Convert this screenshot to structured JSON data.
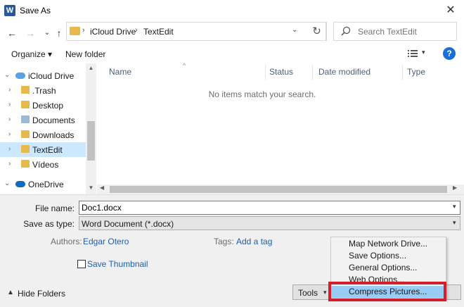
{
  "window": {
    "title": "Save As",
    "app_icon": "W",
    "close": "✕"
  },
  "nav": {
    "back": "←",
    "forward": "→",
    "recent": "⌄",
    "up": "↑",
    "refresh": "↻"
  },
  "address": {
    "segments": [
      "iCloud Drive",
      "TextEdit"
    ],
    "sep": "›",
    "dropdown": "⌄"
  },
  "search": {
    "placeholder": "Search TextEdit"
  },
  "toolbar": {
    "organize": "Organize ▾",
    "new_folder": "New folder",
    "view_chev": "▾",
    "help": "?"
  },
  "sidebar": {
    "items": [
      {
        "label": "iCloud Drive",
        "chev": "⌄",
        "icon": "cloud-icon"
      },
      {
        "label": ".Trash",
        "chev": "›",
        "icon": "folder-icon"
      },
      {
        "label": "Desktop",
        "chev": "›",
        "icon": "folder-icon"
      },
      {
        "label": "Documents",
        "chev": "›",
        "icon": "documents-icon"
      },
      {
        "label": "Downloads",
        "chev": "›",
        "icon": "folder-icon"
      },
      {
        "label": "TextEdit",
        "chev": "›",
        "icon": "folder-icon",
        "selected": true
      },
      {
        "label": "Vídeos",
        "chev": "›",
        "icon": "folder-icon"
      },
      {
        "label": "OneDrive",
        "chev": "⌄",
        "icon": "onedrive-icon"
      }
    ]
  },
  "filelist": {
    "columns": [
      "Name",
      "Status",
      "Date modified",
      "Type"
    ],
    "sort_arrow": "^",
    "empty_message": "No items match your search."
  },
  "form": {
    "file_name_label": "File name:",
    "file_name_value": "Doc1.docx",
    "save_type_label": "Save as type:",
    "save_type_value": "Word Document (*.docx)",
    "authors_label": "Authors:",
    "authors_value": "Edgar Otero",
    "tags_label": "Tags:",
    "tags_value": "Add a tag",
    "thumbnail_label": "Save Thumbnail",
    "hide_folders": "Hide Folders",
    "tools_label": "Tools",
    "dd": "▾"
  },
  "tools_menu": {
    "items": [
      "Map Network Drive...",
      "Save Options...",
      "General Options...",
      "Web Options...",
      "Compress Pictures..."
    ]
  },
  "colors": {
    "accent": "#1a6fd6",
    "highlight": "#d1202c",
    "selection": "#cce8ff",
    "menu_hover": "#99ccf5"
  }
}
